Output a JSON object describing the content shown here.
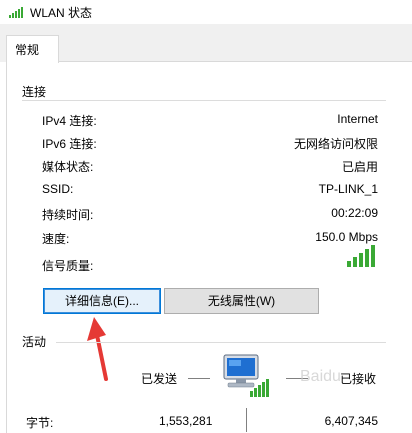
{
  "window": {
    "title": "WLAN 状态"
  },
  "tabs": [
    {
      "label": "常规"
    }
  ],
  "connection": {
    "section_title": "连接",
    "rows": [
      {
        "label": "IPv4 连接:",
        "value": "Internet"
      },
      {
        "label": "IPv6 连接:",
        "value": "无网络访问权限"
      },
      {
        "label": "媒体状态:",
        "value": "已启用"
      },
      {
        "label": "SSID:",
        "value": "TP-LINK_1"
      },
      {
        "label": "持续时间:",
        "value": "00:22:09"
      },
      {
        "label": "速度:",
        "value": "150.0 Mbps"
      }
    ],
    "signal_label": "信号质量:",
    "signal_bars": 5,
    "signal_color": "#3aa935"
  },
  "buttons": {
    "details": "详细信息(E)...",
    "wireless": "无线属性(W)"
  },
  "activity": {
    "section_title": "活动",
    "sent_label": "已发送",
    "received_label": "已接收",
    "bytes_label": "字节:",
    "bytes_sent": "1,553,281",
    "bytes_received": "6,407,345"
  },
  "annotation": {
    "arrow_color": "#e53935"
  },
  "watermark": "Baidu"
}
